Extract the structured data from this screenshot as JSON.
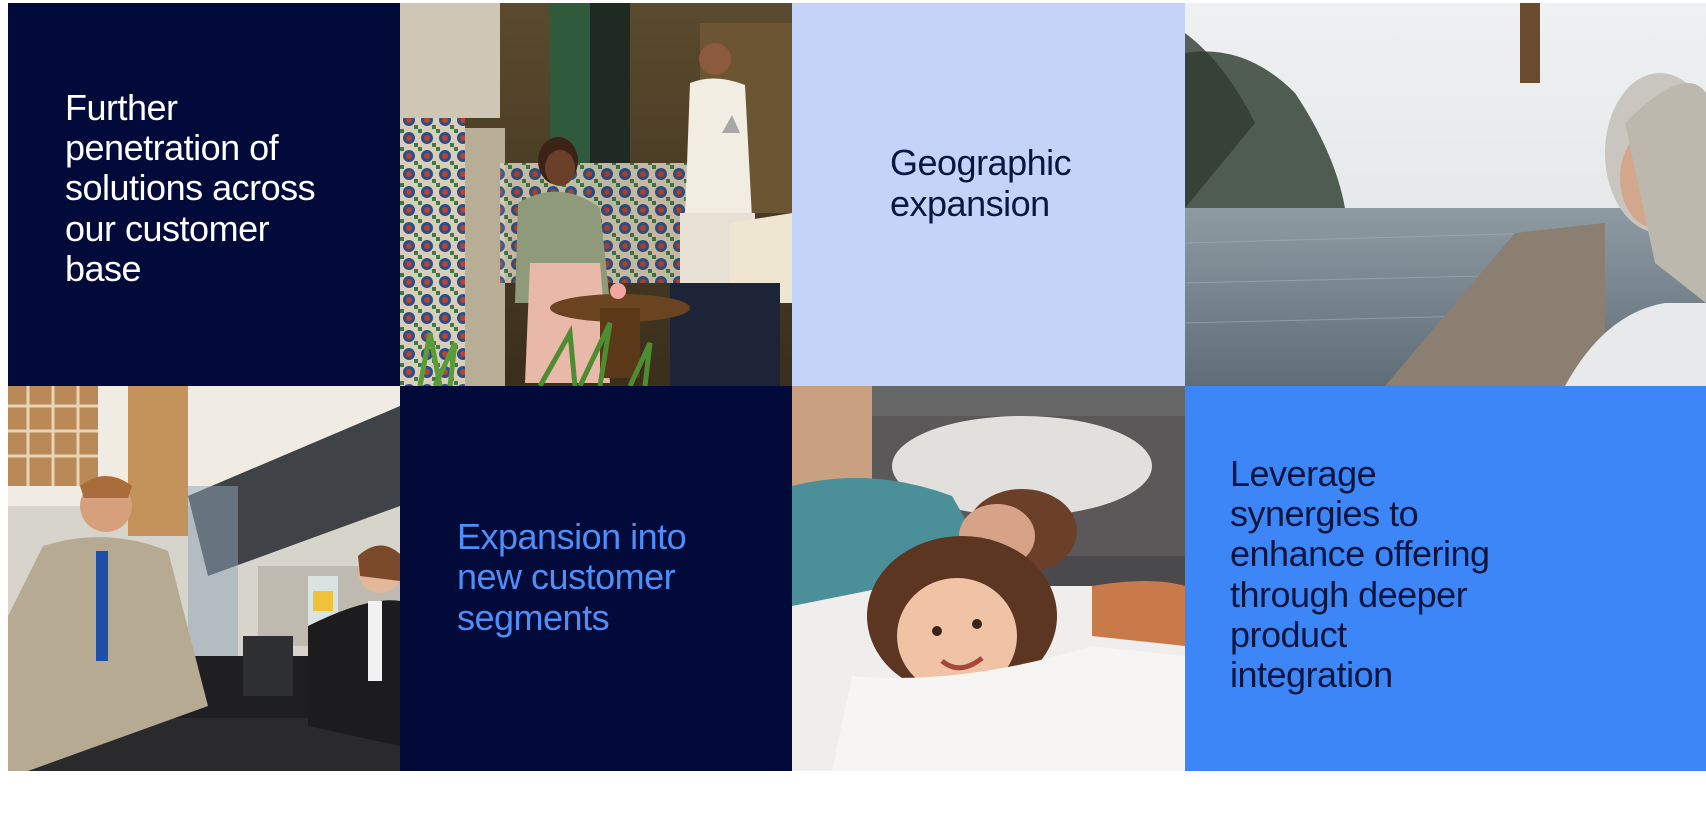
{
  "tiles": {
    "penetration": {
      "text": "Further\npenetration of\nsolutions across\nour customer\nbase",
      "bg": "#020A3A",
      "fg": "#FFFFFF"
    },
    "geographic": {
      "text": "Geographic\nexpansion",
      "bg": "#C4D4F8",
      "fg": "#0A1640"
    },
    "segments": {
      "text": "Expansion into\nnew customer\nsegments",
      "bg": "#020A3A",
      "fg": "#4F8EF7"
    },
    "synergies": {
      "text": "Leverage\nsynergies to\nenhance offering\nthrough deeper\nproduct\nintegration",
      "bg": "#3D86F7",
      "fg": "#0A1640"
    }
  }
}
